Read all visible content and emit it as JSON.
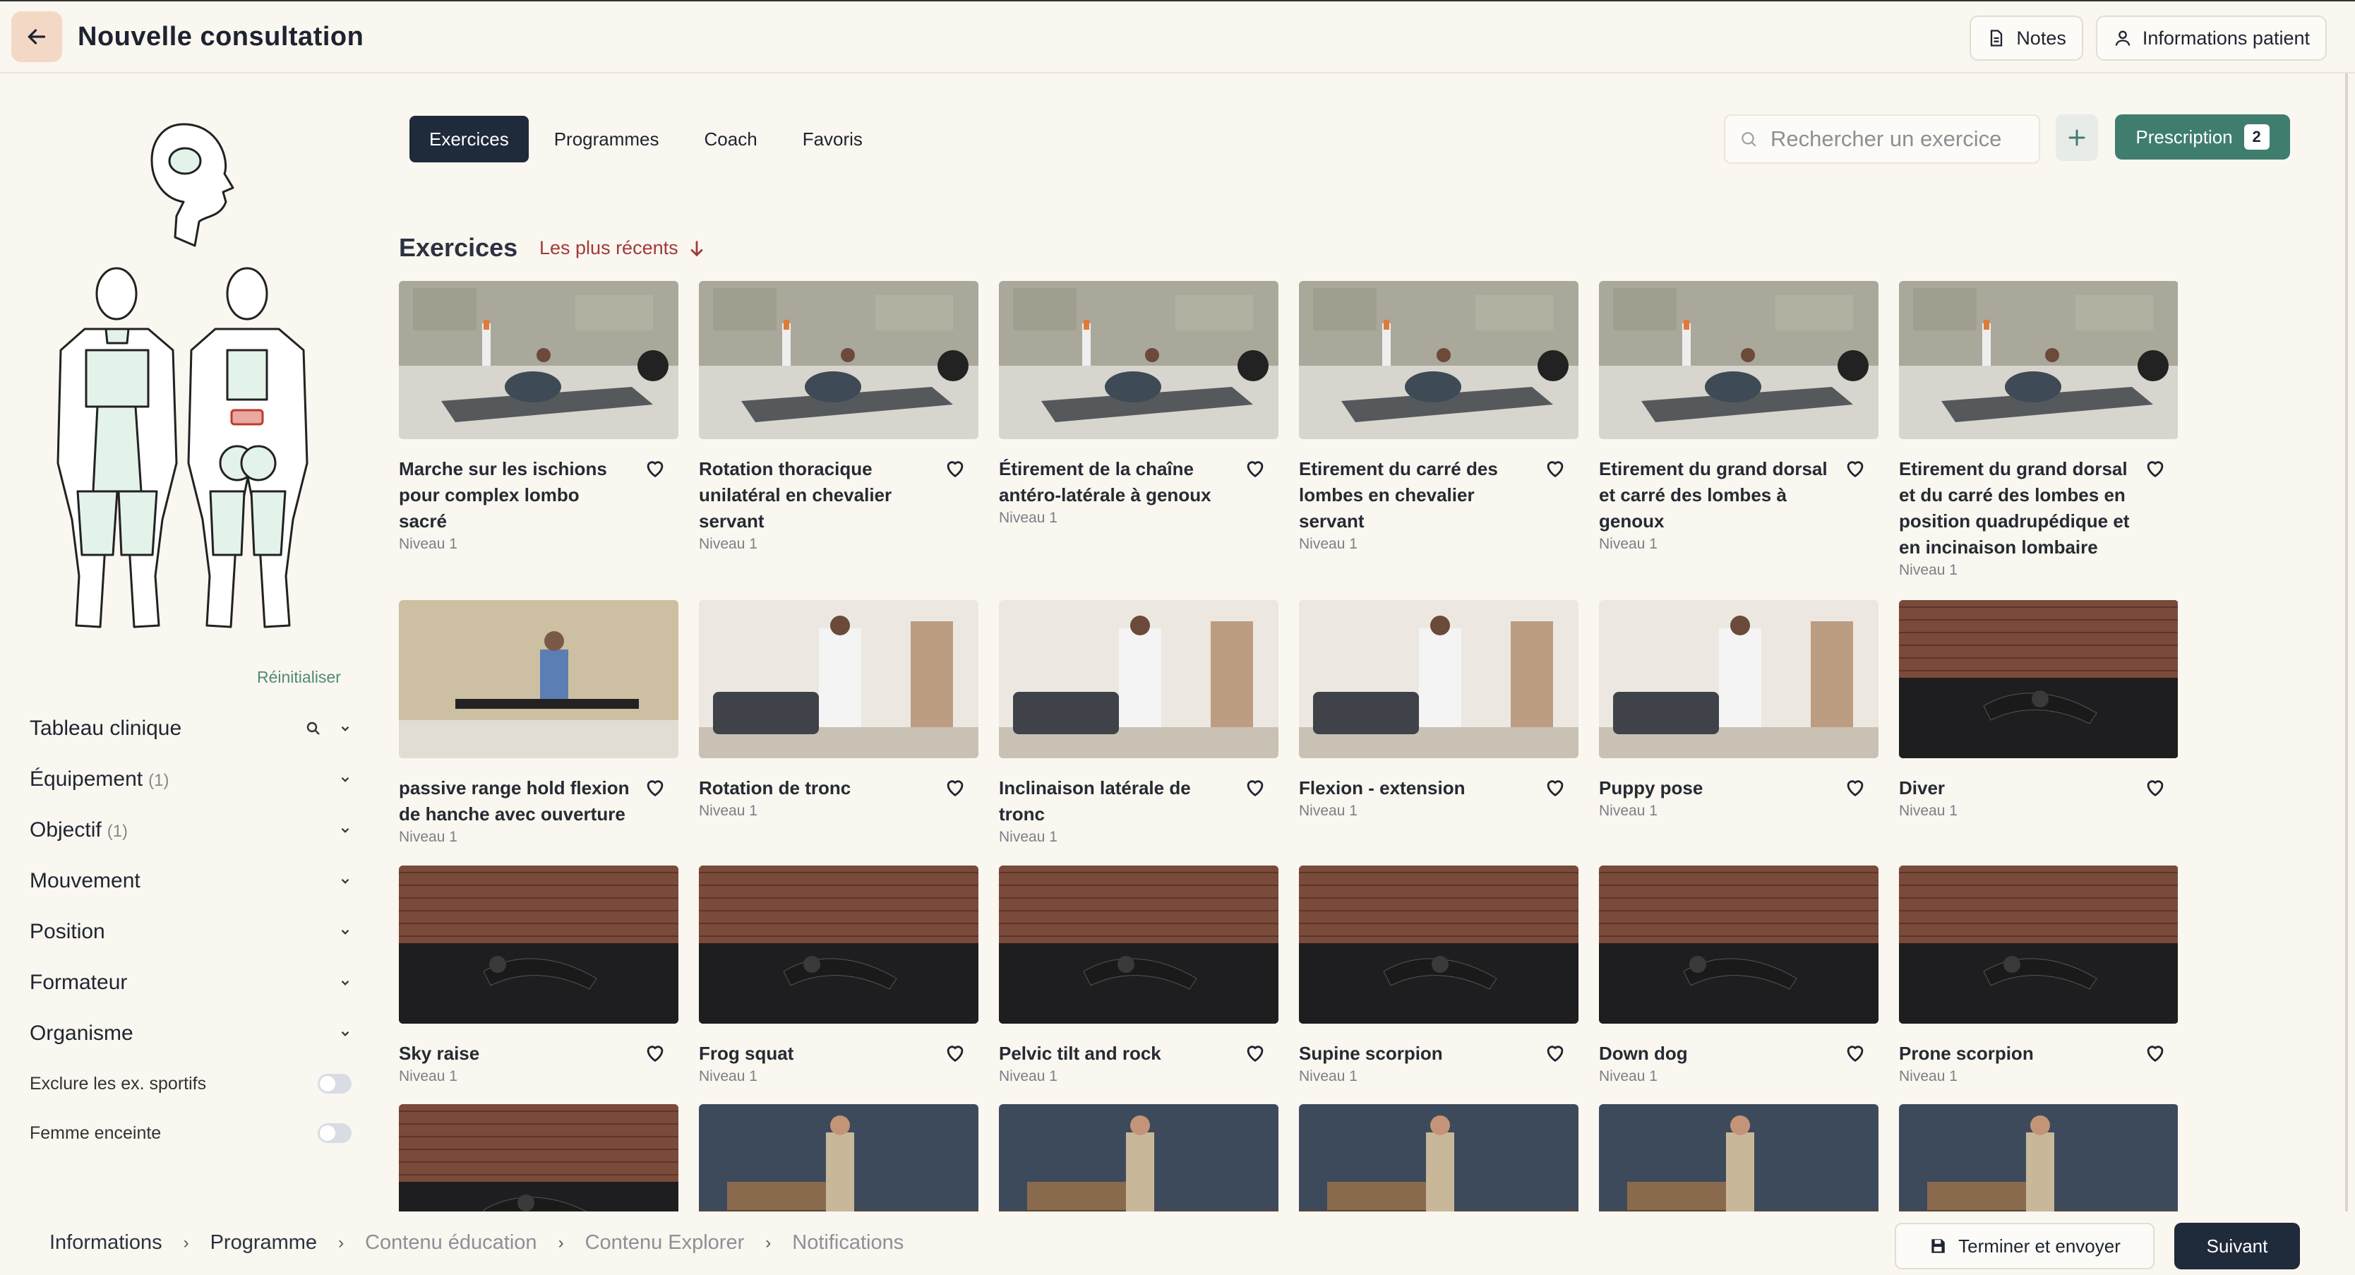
{
  "header": {
    "title": "Nouvelle consultation",
    "notes_label": "Notes",
    "patient_info_label": "Informations patient"
  },
  "tabs": [
    {
      "label": "Exercices",
      "active": true
    },
    {
      "label": "Programmes",
      "active": false
    },
    {
      "label": "Coach",
      "active": false
    },
    {
      "label": "Favoris",
      "active": false
    }
  ],
  "search": {
    "placeholder": "Rechercher un exercice"
  },
  "prescription": {
    "label": "Prescription",
    "count": "2"
  },
  "section": {
    "title": "Exercices",
    "sort_label": "Les plus récents"
  },
  "left": {
    "reset_label": "Réinitialiser",
    "filters": [
      {
        "label": "Tableau clinique",
        "count": "",
        "has_search": true
      },
      {
        "label": "Équipement",
        "count": "(1)",
        "has_search": false
      },
      {
        "label": "Objectif",
        "count": "(1)",
        "has_search": false
      },
      {
        "label": "Mouvement",
        "count": "",
        "has_search": false
      },
      {
        "label": "Position",
        "count": "",
        "has_search": false
      },
      {
        "label": "Formateur",
        "count": "",
        "has_search": false
      },
      {
        "label": "Organisme",
        "count": "",
        "has_search": false
      }
    ],
    "toggles": [
      {
        "label": "Exclure les ex. sportifs",
        "on": false
      },
      {
        "label": "Femme enceinte",
        "on": false
      }
    ]
  },
  "exercises": [
    {
      "title": "Marche sur les ischions pour complex lombo sacré",
      "level": "Niveau 1",
      "scene": "studio"
    },
    {
      "title": "Rotation thoracique unilatéral en chevalier servant",
      "level": "Niveau 1",
      "scene": "studio"
    },
    {
      "title": "Étirement de la chaîne antéro-latérale à genoux",
      "level": "Niveau 1",
      "scene": "studio"
    },
    {
      "title": "Etirement du carré des lombes en chevalier servant",
      "level": "Niveau 1",
      "scene": "studio"
    },
    {
      "title": "Etirement du grand dorsal et carré des lombes à genoux",
      "level": "Niveau 1",
      "scene": "studio"
    },
    {
      "title": "Etirement du grand dorsal et du carré des lombes en position quadrupédique et en incinaison lombaire",
      "level": "Niveau 1",
      "scene": "studio"
    },
    {
      "title": "passive range hold flexion de hanche avec ouverture",
      "level": "Niveau 1",
      "scene": "wall"
    },
    {
      "title": "Rotation de tronc",
      "level": "Niveau 1",
      "scene": "room"
    },
    {
      "title": "Inclinaison latérale de tronc",
      "level": "Niveau 1",
      "scene": "room"
    },
    {
      "title": "Flexion - extension",
      "level": "Niveau 1",
      "scene": "room"
    },
    {
      "title": "Puppy pose",
      "level": "Niveau 1",
      "scene": "room"
    },
    {
      "title": "Diver",
      "level": "Niveau 1",
      "scene": "brick"
    },
    {
      "title": "Sky raise",
      "level": "Niveau 1",
      "scene": "brick"
    },
    {
      "title": "Frog squat",
      "level": "Niveau 1",
      "scene": "brick"
    },
    {
      "title": "Pelvic tilt and rock",
      "level": "Niveau 1",
      "scene": "brick"
    },
    {
      "title": "Supine scorpion",
      "level": "Niveau 1",
      "scene": "brick"
    },
    {
      "title": "Down dog",
      "level": "Niveau 1",
      "scene": "brick"
    },
    {
      "title": "Prone scorpion",
      "level": "Niveau 1",
      "scene": "brick"
    },
    {
      "title": "",
      "level": "",
      "scene": "brick"
    },
    {
      "title": "",
      "level": "",
      "scene": "kitchen"
    },
    {
      "title": "",
      "level": "",
      "scene": "kitchen"
    },
    {
      "title": "",
      "level": "",
      "scene": "kitchen"
    },
    {
      "title": "",
      "level": "",
      "scene": "kitchen"
    },
    {
      "title": "",
      "level": "",
      "scene": "kitchen"
    }
  ],
  "breadcrumbs": [
    {
      "label": "Informations",
      "dim": false
    },
    {
      "label": "Programme",
      "dim": false
    },
    {
      "label": "Contenu éducation",
      "dim": true
    },
    {
      "label": "Contenu Explorer",
      "dim": true
    },
    {
      "label": "Notifications",
      "dim": true
    }
  ],
  "footer": {
    "finish_label": "Terminer et envoyer",
    "next_label": "Suivant"
  },
  "colors": {
    "accent": "#3f7d6f",
    "dark": "#1f2a3b",
    "sort": "#a03b3b",
    "background": "#faf6f0"
  },
  "icons": [
    "arrow-left-icon",
    "document-icon",
    "user-icon",
    "search-icon",
    "plus-icon",
    "arrow-down-icon",
    "chevron-down-icon",
    "heart-icon",
    "save-icon"
  ]
}
